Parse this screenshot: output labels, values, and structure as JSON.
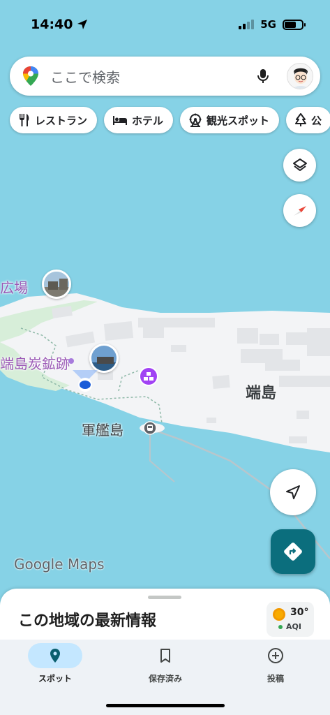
{
  "status": {
    "time": "14:40",
    "network": "5G"
  },
  "search": {
    "placeholder": "ここで検索"
  },
  "chips": [
    {
      "label": "レストラン",
      "icon": "fork-knife-icon"
    },
    {
      "label": "ホテル",
      "icon": "bed-icon"
    },
    {
      "label": "観光スポット",
      "icon": "ferris-wheel-icon"
    },
    {
      "label": "公",
      "icon": "tree-icon"
    }
  ],
  "map": {
    "labels": {
      "plaza": "広場",
      "mine_ruins": "端島炭鉱跡",
      "island": "端島",
      "gunkanjima": "軍艦島"
    },
    "logo": "Google Maps"
  },
  "sheet": {
    "title": "この地域の最新情報",
    "temperature": "30°",
    "aqi": "AQI"
  },
  "tabs": [
    {
      "label": "スポット",
      "icon": "location-pin-icon",
      "active": true
    },
    {
      "label": "保存済み",
      "icon": "bookmark-icon",
      "active": false
    },
    {
      "label": "投稿",
      "icon": "plus-circle-icon",
      "active": false
    }
  ],
  "colors": {
    "water": "#86d2e6",
    "land": "#f3f4f6",
    "park": "#d7eed9",
    "accent": "#0b6e7d",
    "place_label": "#9b59b6"
  }
}
